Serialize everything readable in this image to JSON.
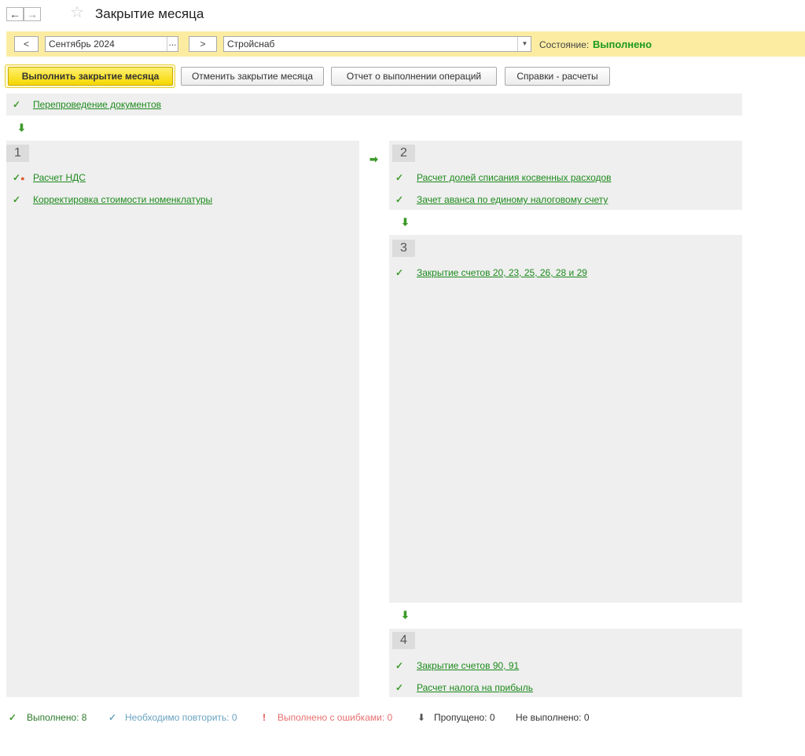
{
  "window": {
    "title": "Закрытие месяца",
    "back_icon": "arrow-left-icon",
    "forward_icon": "arrow-right-icon",
    "favorite_icon": "star-icon"
  },
  "toolbar": {
    "prev_label": "<",
    "period_value": "Сентябрь 2024",
    "period_choose_label": "...",
    "next_label": ">",
    "org_value": "Стройснаб",
    "status_label": "Состояние:",
    "status_value": "Выполнено"
  },
  "actions": {
    "execute_label": "Выполнить закрытие месяца",
    "cancel_label": "Отменить закрытие месяца",
    "report_label": "Отчет о выполнении операций",
    "help_label": "Справки - расчеты"
  },
  "steps": {
    "pre": {
      "item": "Перепроведение документов"
    },
    "s1": {
      "number": "1",
      "items": [
        "Расчет НДС",
        "Корректировка стоимости номенклатуры"
      ]
    },
    "s2": {
      "number": "2",
      "items": [
        "Расчет долей списания косвенных расходов",
        "Зачет аванса по единому налоговому счету"
      ]
    },
    "s3": {
      "number": "3",
      "items": [
        "Закрытие счетов 20, 23, 25, 26, 28 и 29"
      ]
    },
    "s4": {
      "number": "4",
      "items": [
        "Закрытие счетов 90, 91",
        "Расчет налога на прибыль"
      ]
    }
  },
  "footer": {
    "done": "Выполнено: 8",
    "repeat": "Необходимо повторить: 0",
    "errors": "Выполнено с ошибками: 0",
    "skipped": "Пропущено: 0",
    "not_done": "Не выполнено: 0"
  },
  "colors": {
    "accent_green": "#1d8a1d",
    "status_bar": "#fbeca2",
    "primary_button": "#f5d700"
  }
}
